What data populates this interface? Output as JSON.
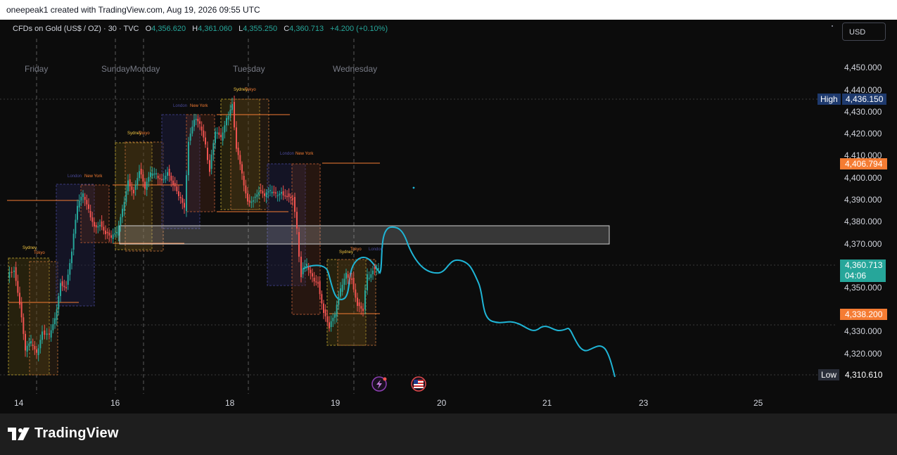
{
  "attribution": "oneepeak1 created with TradingView.com, Aug 19, 2026 09:55 UTC",
  "legend": {
    "symbol": "CFDs on Gold (US$ / OZ) · 30 · TVC",
    "open_key": "O",
    "open": "4,356.620",
    "high_key": "H",
    "high": "4,361.060",
    "low_key": "L",
    "low": "4,355.250",
    "close_key": "C",
    "close": "4,360.713",
    "change": "+4.200 (+0.10%)"
  },
  "currency": "USD",
  "days": [
    "Friday",
    "SundayMonday",
    "Tuesday",
    "Wednesday"
  ],
  "price_axis": [
    "4,450.000",
    "4,440.000",
    "4,430.000",
    "4,420.000",
    "4,410.000",
    "4,400.000",
    "4,390.000",
    "4,380.000",
    "4,370.000",
    "4,350.000",
    "4,330.000",
    "4,320.000"
  ],
  "time_axis": [
    "14",
    "16",
    "18",
    "19",
    "20",
    "21",
    "23",
    "25"
  ],
  "tags": {
    "high_label": "High",
    "high_value": "4,436.150",
    "low_label": "Low",
    "low_value": "4,310.610",
    "level_1": "4,406.794",
    "current_price": "4,360.713",
    "countdown": "04:06",
    "level_2": "4,338.200"
  },
  "session_labels": [
    "Sydney",
    "Tokyo",
    "London",
    "New York"
  ],
  "brand": "TradingView",
  "colors": {
    "bull": "#26a69a",
    "bear": "#ef5350",
    "projection": "#1fb5d6",
    "zone_fill": "#ffffff",
    "level_line": "#f57c33",
    "high_tag": "#1e3a6e"
  },
  "icons": [
    "lightning-event-icon",
    "us-flag-event-icon",
    "tradingview-logo-icon"
  ]
}
